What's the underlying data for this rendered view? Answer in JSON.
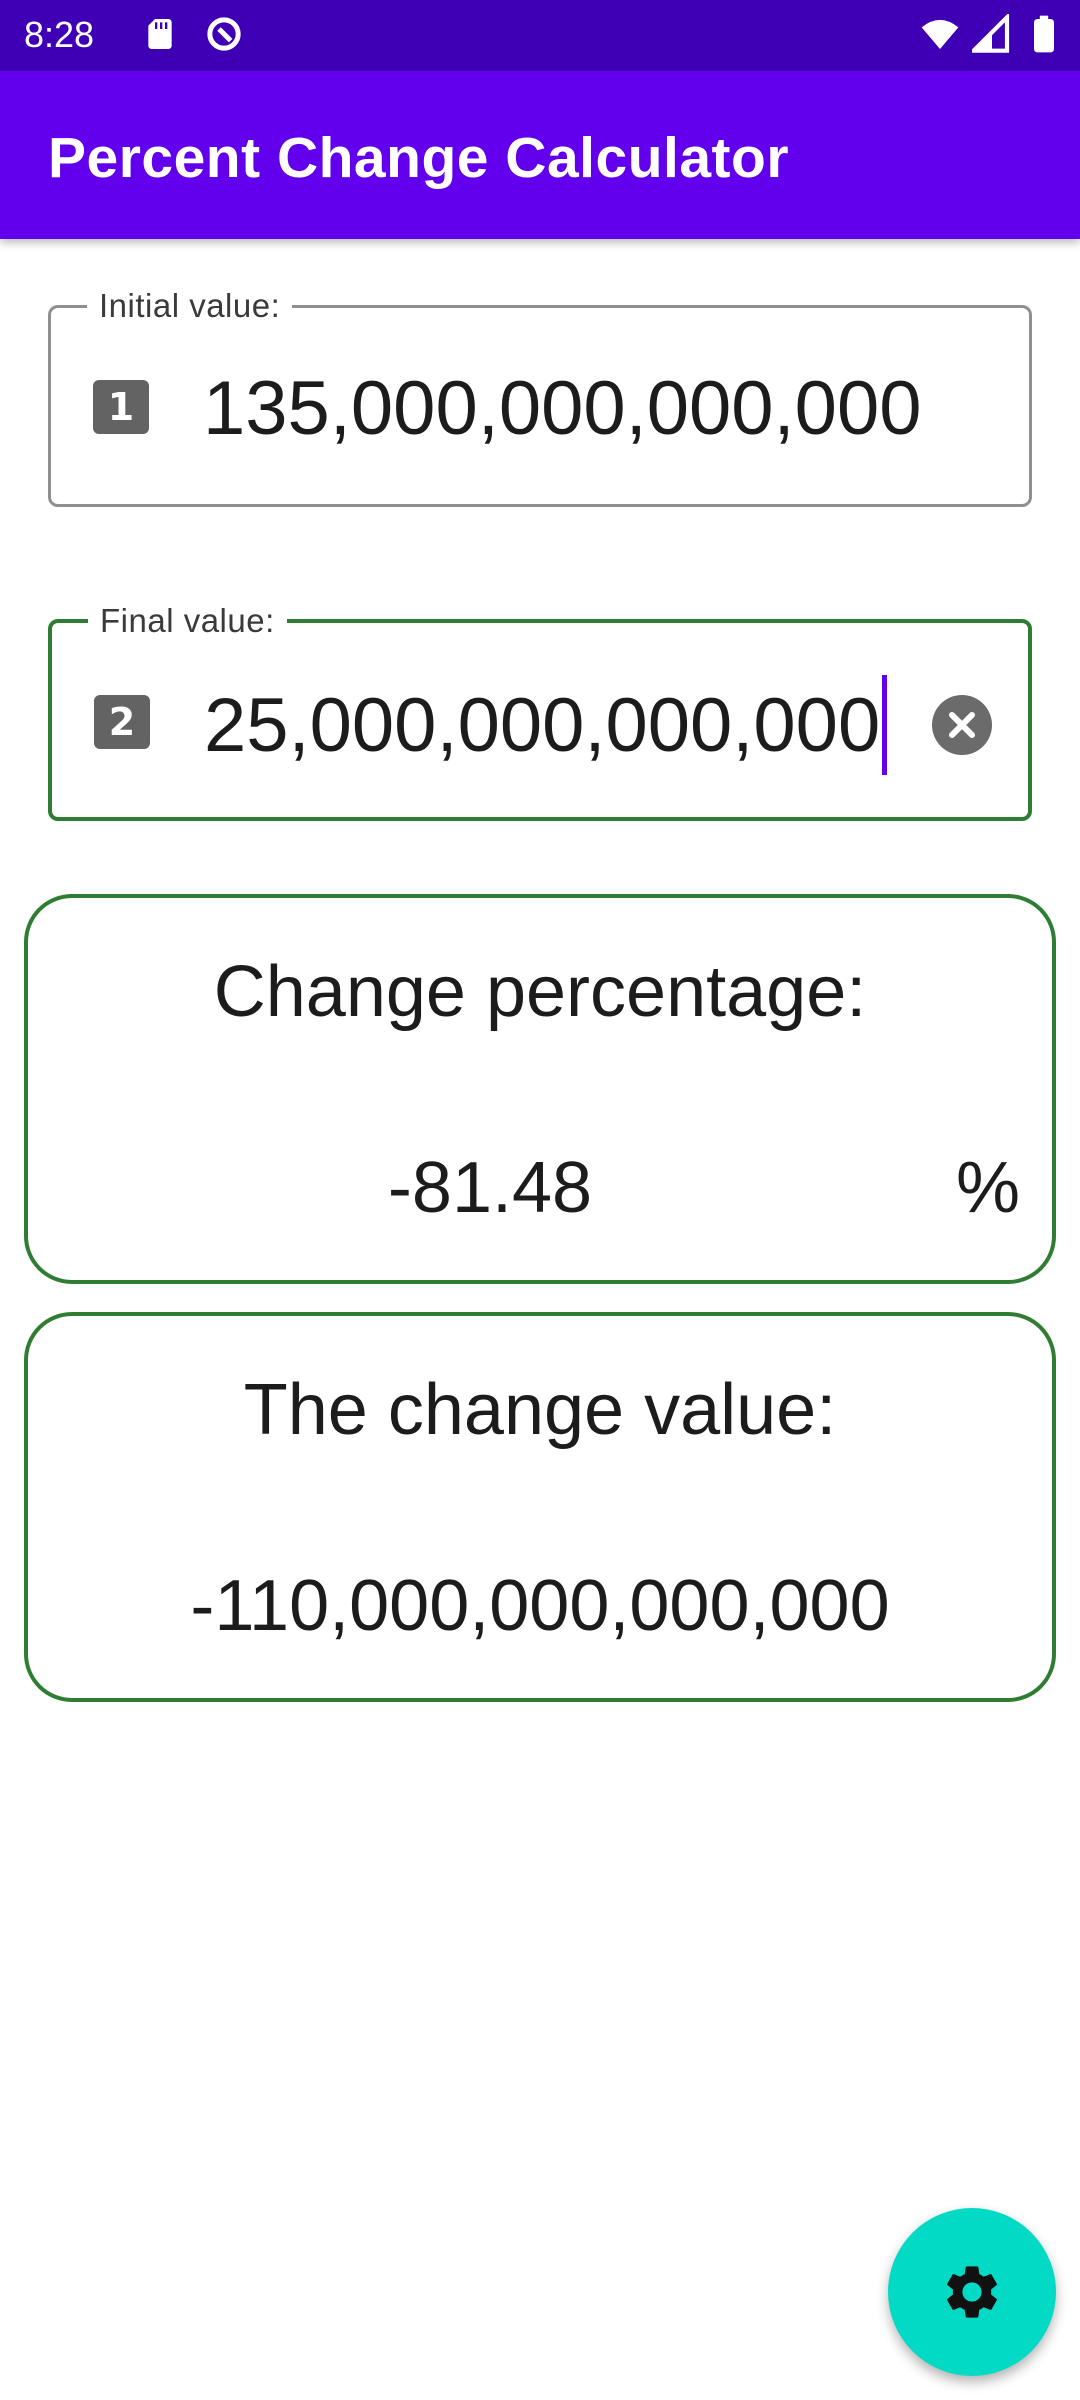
{
  "status_bar": {
    "time": "8:28",
    "left_icons": [
      "sd-card-icon",
      "data-saver-icon"
    ],
    "right_icons": [
      "wifi-icon",
      "signal-icon",
      "battery-icon"
    ]
  },
  "app_bar": {
    "title": "Percent Change Calculator"
  },
  "initial_field": {
    "label": "Initial value:",
    "icon_glyph": "1",
    "value": "135,000,000,000,000"
  },
  "final_field": {
    "label": "Final value:",
    "icon_glyph": "2",
    "value": "25,000,000,000,000"
  },
  "percentage_card": {
    "title": "Change percentage:",
    "value": "-81.48",
    "unit": "%"
  },
  "change_card": {
    "title": "The change value:",
    "value": "-110,000,000,000,000"
  },
  "fab": {
    "icon": "gear-icon"
  },
  "colors": {
    "status_bar": "#3f00b5",
    "app_bar": "#6200ee",
    "active_border": "#2e7d32",
    "fab": "#03dac5",
    "caret": "#6200ee"
  }
}
